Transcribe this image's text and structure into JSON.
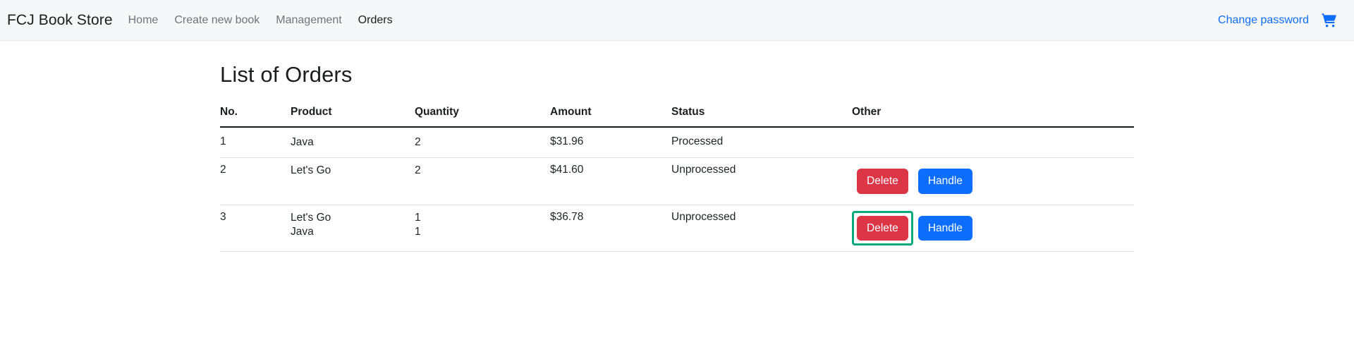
{
  "navbar": {
    "brand": "FCJ Book Store",
    "links": [
      {
        "label": "Home",
        "active": false
      },
      {
        "label": "Create new book",
        "active": false
      },
      {
        "label": "Management",
        "active": false
      },
      {
        "label": "Orders",
        "active": true
      }
    ],
    "change_password_label": "Change password",
    "cart_icon": "shopping-cart-icon",
    "link_color": "#0d6efd",
    "background": "#f6f7f9"
  },
  "main": {
    "title": "List of Orders",
    "table": {
      "headers": [
        "No.",
        "Product",
        "Quantity",
        "Amount",
        "Status",
        "Other"
      ],
      "rows": [
        {
          "no": "1",
          "products": [
            "Java"
          ],
          "quantities": [
            "2"
          ],
          "amount": "$31.96",
          "status": "Processed",
          "buttons": []
        },
        {
          "no": "2",
          "products": [
            "Let's Go"
          ],
          "quantities": [
            "2"
          ],
          "amount": "$41.60",
          "status": "Unprocessed",
          "buttons": [
            {
              "label": "Delete",
              "style": "danger",
              "highlighted": false
            },
            {
              "label": "Handle",
              "style": "primary",
              "highlighted": false
            }
          ]
        },
        {
          "no": "3",
          "products": [
            "Let's Go",
            "Java"
          ],
          "quantities": [
            "1",
            "1"
          ],
          "amount": "$36.78",
          "status": "Unprocessed",
          "buttons": [
            {
              "label": "Delete",
              "style": "danger",
              "highlighted": true
            },
            {
              "label": "Handle",
              "style": "primary",
              "highlighted": false
            }
          ]
        }
      ]
    }
  },
  "colors": {
    "delete_button": "#dc3545",
    "handle_button": "#0d6efd",
    "highlight_outline": "#0aa87d",
    "header_rule": "#171a1c",
    "row_rule": "#dee2e6"
  }
}
